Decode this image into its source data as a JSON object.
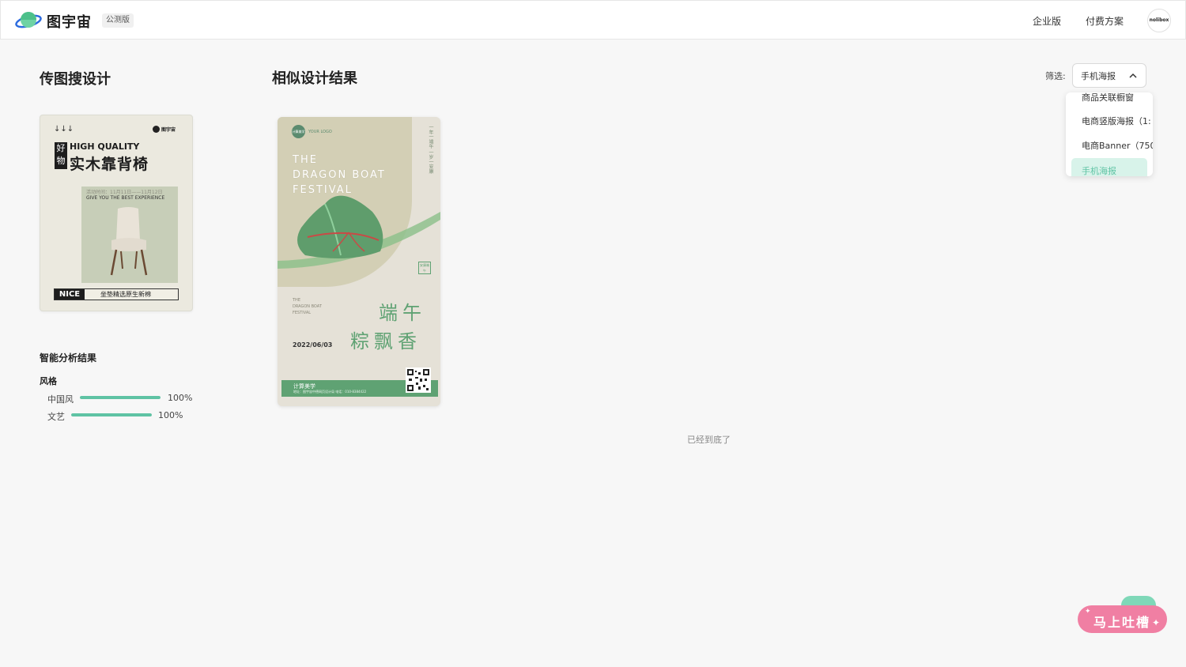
{
  "header": {
    "logo_text": "图宇宙",
    "beta_badge": "公测版",
    "nav": {
      "enterprise": "企业版",
      "pricing": "付费方案"
    },
    "avatar_text": "nolibox"
  },
  "left": {
    "title": "传图搜设计",
    "upload_poster": {
      "arrows": "↓↓↓",
      "brand": "图宇宙",
      "tag": "好物",
      "headline_en": "HIGH QUALITY",
      "headline_cn": "实木靠背椅",
      "event_line": "活动时间：11月11日——11月12日",
      "slogan": "GIVE YOU THE BEST EXPERIENCE",
      "nice": "NICE",
      "nice_text": "坐垫精选原生新棉"
    },
    "analysis": {
      "title": "智能分析结果",
      "style_label": "风格",
      "metrics": [
        {
          "label": "中国风",
          "value": "100%",
          "fraction": 1.0
        },
        {
          "label": "文艺",
          "value": "100%",
          "fraction": 1.0
        }
      ]
    }
  },
  "results": {
    "title": "相似设计结果",
    "card": {
      "logo_circle": "计算美学",
      "logo_text": "YOUR LOGO",
      "title_en": "THE\nDRAGON BOAT\nFESTIVAL",
      "vertical_text": "一年一端午 一岁一安康",
      "seal": "安康端午",
      "small_en": "THE\nDRAGON BOAT\nFESTIVAL",
      "cn_line1": "端午",
      "cn_line2": "粽飘香",
      "date": "2022/06/03",
      "footer_brand": "计算美学",
      "footer_addr": "地址：图宇宙中德网页设计局    电话：010-8384422"
    },
    "end_text": "已经到底了"
  },
  "filter": {
    "label": "筛选:",
    "selected": "手机海报",
    "options": [
      "商品关联橱窗",
      "电商竖版海报（1:",
      "电商Banner（750",
      "手机海报"
    ]
  },
  "feedback": {
    "label": "马上吐槽"
  },
  "colors": {
    "accent": "#5fc3a4",
    "poster_green": "#5fa273",
    "feedback_pink": "#f07fa3"
  }
}
